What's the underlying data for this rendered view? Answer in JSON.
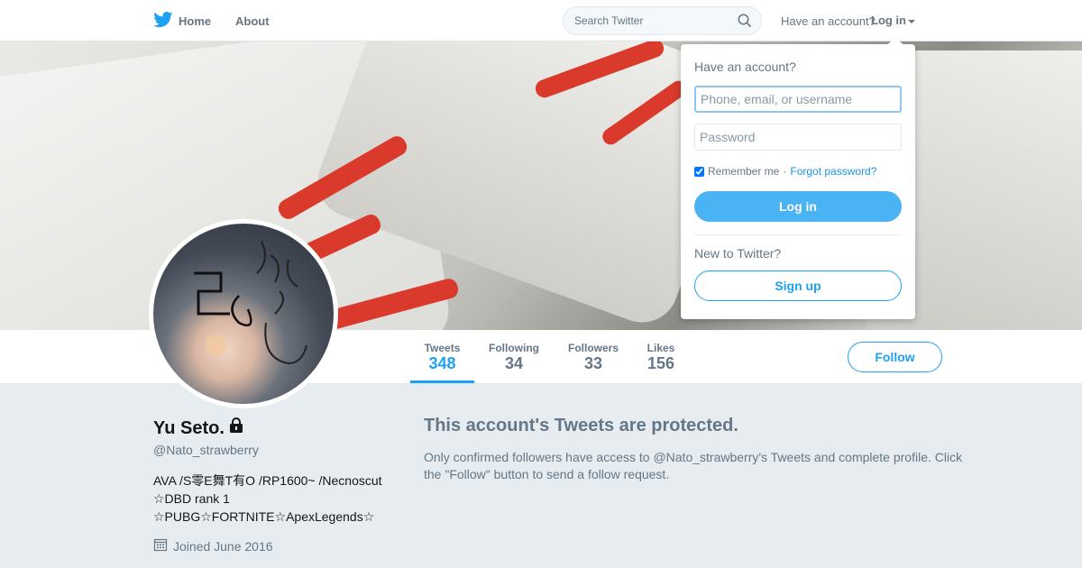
{
  "nav": {
    "home_label": "Home",
    "about_label": "About",
    "search_placeholder": "Search Twitter",
    "have_account": "Have an account?",
    "login_label": "Log in"
  },
  "profile": {
    "name": "Yu Seto.",
    "handle": "@Nato_strawberry",
    "bio_lines": [
      "AVA /S零E舞T有O /RP1600~ /Necnoscut",
      "☆DBD rank 1",
      "☆PUBG☆FORTNITE☆ApexLegends☆"
    ],
    "joined": "Joined June 2016"
  },
  "stats": [
    {
      "label": "Tweets",
      "value": "348"
    },
    {
      "label": "Following",
      "value": "34"
    },
    {
      "label": "Followers",
      "value": "33"
    },
    {
      "label": "Likes",
      "value": "156"
    }
  ],
  "follow_label": "Follow",
  "protected": {
    "title": "This account's Tweets are protected.",
    "text": "Only confirmed followers have access to @Nato_strawberry's Tweets and complete profile. Click the \"Follow\" button to send a follow request."
  },
  "login_dropdown": {
    "title": "Have an account?",
    "username_placeholder": "Phone, email, or username",
    "password_placeholder": "Password",
    "remember_label": "Remember me",
    "separator": "·",
    "forgot_label": "Forgot password?",
    "login_button": "Log in",
    "new_label": "New to Twitter?",
    "signup_button": "Sign up"
  },
  "colors": {
    "accent": "#1da1f2",
    "background": "#e6ecf0"
  }
}
